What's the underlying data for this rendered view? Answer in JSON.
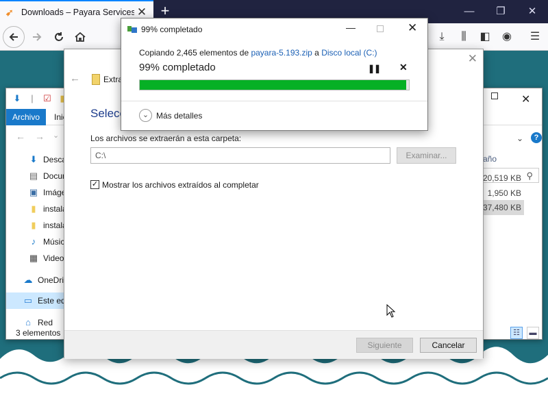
{
  "browser": {
    "tab_title": "Downloads – Payara Services Lt",
    "tab_close": "✕",
    "new_tab": "+"
  },
  "explorer": {
    "ribbon_file": "Archivo",
    "ribbon_tab": "Inic",
    "sidebar": [
      {
        "label": "Desca",
        "icon": "download-icon"
      },
      {
        "label": "Docur",
        "icon": "document-icon"
      },
      {
        "label": "Imáge",
        "icon": "image-icon"
      },
      {
        "label": "instala",
        "icon": "folder-icon"
      },
      {
        "label": "instala",
        "icon": "folder-icon"
      },
      {
        "label": "Músic",
        "icon": "music-icon"
      },
      {
        "label": "Videos",
        "icon": "video-icon"
      },
      {
        "label": "OneDriv",
        "icon": "cloud-icon"
      },
      {
        "label": "Este equ",
        "icon": "computer-icon"
      },
      {
        "label": "Red",
        "icon": "network-icon"
      }
    ],
    "size_header": "año",
    "sizes": [
      "20,519 KB",
      "1,950 KB",
      "37,480 KB"
    ],
    "status": "3 elementos"
  },
  "wizard": {
    "title": "Extra",
    "heading": "Selecc",
    "folder_label": "Los archivos se extraerán a esta carpeta:",
    "path_value": "C:\\",
    "browse_label": "Examinar...",
    "checkbox_label": "Mostrar los archivos extraídos al completar",
    "checkbox_checked": true,
    "next_label": "Siguiente",
    "cancel_label": "Cancelar"
  },
  "progress": {
    "title": "99% completado",
    "copying_prefix": "Copiando 2,465 elementos de ",
    "source": "payara-5.193.zip",
    "copying_mid": " a ",
    "destination": "Disco local (C:)",
    "percent_label": "99% completado",
    "percent": 99,
    "more_details": "Más detalles"
  },
  "colors": {
    "progress_fill": "#06b025",
    "link": "#1a5fb4",
    "heading": "#1c3c8c",
    "ribbon_file": "#1979ca",
    "tabbar": "#202340",
    "wallpaper": "#1f6e7c"
  }
}
